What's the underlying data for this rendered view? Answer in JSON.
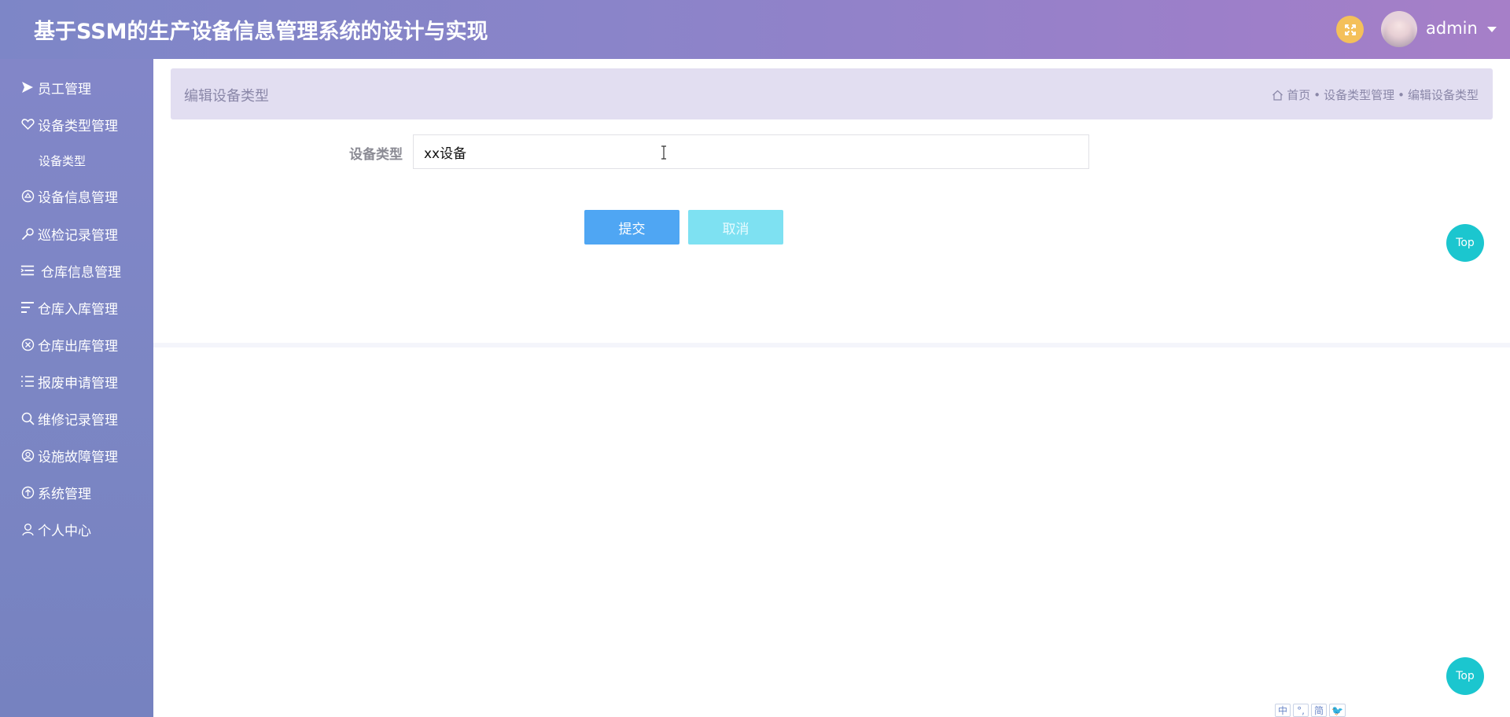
{
  "header": {
    "title": "基于SSM的生产设备信息管理系统的设计与实现",
    "username": "admin"
  },
  "sidebar": {
    "items": [
      {
        "label": "员工管理",
        "icon": "send-icon"
      },
      {
        "label": "设备类型管理",
        "icon": "heart-icon"
      },
      {
        "label": "设备信息管理",
        "icon": "badge-icon"
      },
      {
        "label": "巡检记录管理",
        "icon": "key-icon"
      },
      {
        "label": "仓库信息管理",
        "icon": "indent-icon"
      },
      {
        "label": "仓库入库管理",
        "icon": "align-left-icon"
      },
      {
        "label": "仓库出库管理",
        "icon": "circle-close-icon"
      },
      {
        "label": "报废申请管理",
        "icon": "list-icon"
      },
      {
        "label": "维修记录管理",
        "icon": "search-icon"
      },
      {
        "label": "设施故障管理",
        "icon": "user-circle-icon"
      },
      {
        "label": "系统管理",
        "icon": "arrow-up-circle-icon"
      },
      {
        "label": "个人中心",
        "icon": "user-icon"
      }
    ],
    "submenu": {
      "label": "设备类型"
    }
  },
  "page": {
    "title": "编辑设备类型",
    "breadcrumb": [
      "首页",
      "设备类型管理",
      "编辑设备类型"
    ],
    "breadcrumb_sep": "•"
  },
  "form": {
    "label": "设备类型",
    "value": "xx设备",
    "submit_label": "提交",
    "cancel_label": "取消"
  },
  "top_button": {
    "label": "Top"
  },
  "lang_bar": [
    "中",
    "°,",
    "简",
    "🐦"
  ],
  "colors": {
    "header_gradient_start": "#7d86c7",
    "header_gradient_end": "#a67fc8",
    "sidebar": "#7c86c4",
    "submit": "#4fa6f3",
    "cancel": "#7ee1f2",
    "top_button": "#1bc6cf",
    "fullscreen_button": "#f4c05a"
  }
}
